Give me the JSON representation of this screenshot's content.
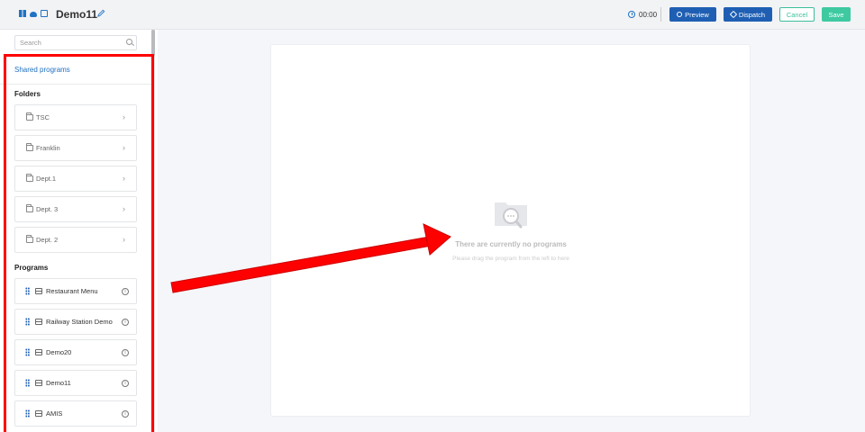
{
  "header": {
    "title": "Demo11",
    "timer": "00:00",
    "buttons": {
      "preview": "Preview",
      "dispatch": "Dispatch",
      "cancel": "Cancel",
      "save": "Save"
    }
  },
  "sidebar": {
    "search_placeholder": "Search",
    "shared_link": "Shared programs",
    "folders_label": "Folders",
    "folders": [
      "TSC",
      "Franklin",
      "Dept.1",
      "Dept. 3",
      "Dept. 2"
    ],
    "programs_label": "Programs",
    "programs": [
      "Restaurant Menu",
      "Railway Station Demo",
      "Demo20",
      "Demo11",
      "AMIS"
    ]
  },
  "canvas": {
    "empty_title": "There are currently no programs",
    "empty_subtitle": "Please drag the program from the left to here"
  },
  "colors": {
    "primary": "#1f5fb3",
    "accent_green": "#3ec9a1",
    "highlight": "#ff0000"
  }
}
